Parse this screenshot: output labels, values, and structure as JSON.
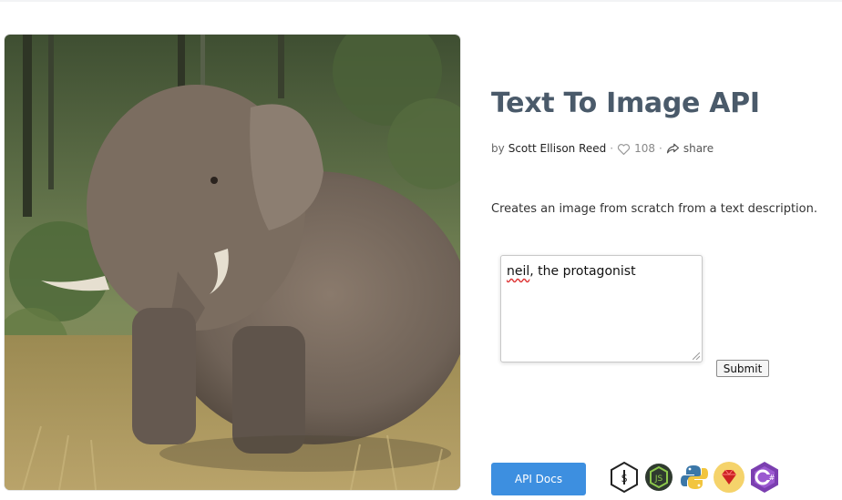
{
  "page": {
    "title": "Text To Image API",
    "by_prefix": "by",
    "author": "Scott Ellison Reed",
    "separator": "·",
    "likes": "108",
    "share_label": "share",
    "description": "Creates an image from scratch from a text description."
  },
  "form": {
    "prompt_value_part1": "neil",
    "prompt_value_part2": ", the protagonist",
    "submit_label": "Submit"
  },
  "footer": {
    "api_docs_label": "API Docs",
    "language_icons": [
      "shell-icon",
      "nodejs-icon",
      "python-icon",
      "ruby-icon",
      "csharp-icon"
    ]
  },
  "colors": {
    "title": "#4a5a6a",
    "api_docs_bg": "#3d8fe0"
  }
}
